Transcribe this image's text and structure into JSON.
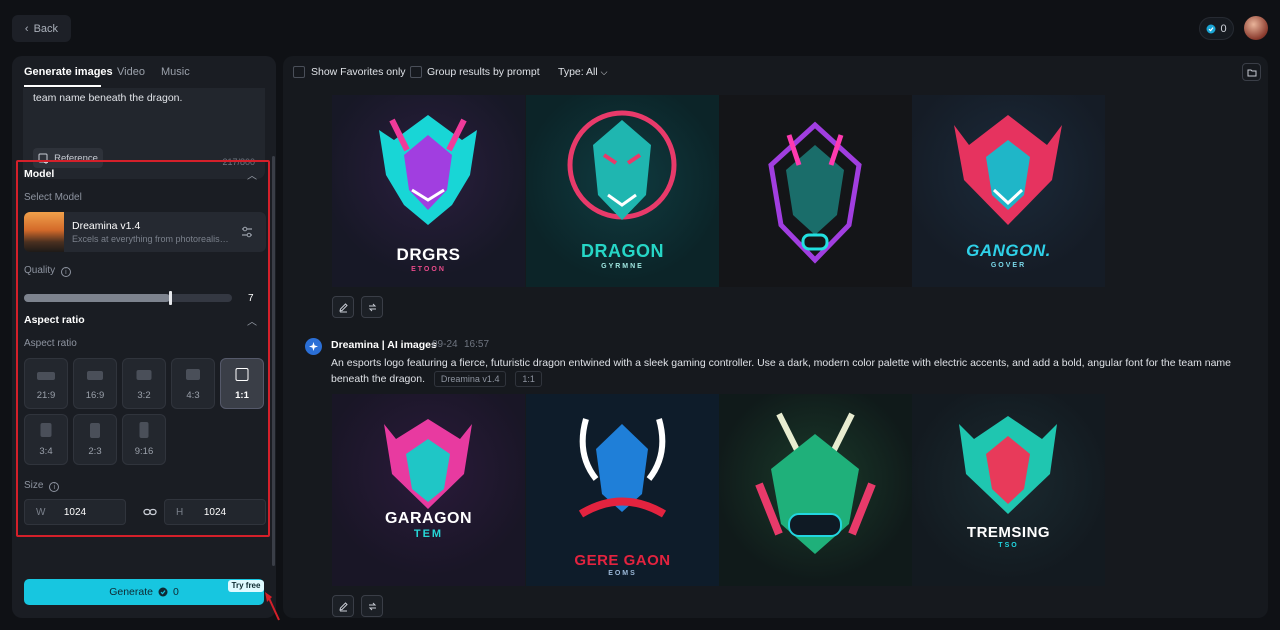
{
  "topbar": {
    "back_label": "Back",
    "credits": "0"
  },
  "left": {
    "tabs": [
      "Generate images",
      "Video",
      "Music"
    ],
    "prompt_tail": "team name beneath the dragon.",
    "reference_label": "Reference",
    "char_count": "217/800",
    "model": {
      "section_title": "Model",
      "select_label": "Select Model",
      "name": "Dreamina v1.4",
      "desc": "Excels at everything from photorealism..."
    },
    "quality": {
      "label": "Quality",
      "value": "7",
      "level_fraction": 0.7
    },
    "aspect": {
      "section_title": "Aspect ratio",
      "label": "Aspect ratio",
      "options": [
        "21:9",
        "16:9",
        "3:2",
        "4:3",
        "1:1",
        "3:4",
        "2:3",
        "9:16"
      ],
      "selected": "1:1"
    },
    "size": {
      "label": "Size",
      "w_label": "W",
      "w_value": "1024",
      "h_label": "H",
      "h_value": "1024"
    },
    "generate": {
      "label": "Generate",
      "credits": "0",
      "badge": "Try free"
    }
  },
  "main": {
    "filters": {
      "favorites": "Show Favorites only",
      "group": "Group results by prompt",
      "type": "Type: All"
    },
    "group1": {
      "images": [
        {
          "text": "DRGRS",
          "sub": "ETOON"
        },
        {
          "text": "DRAGON",
          "sub": "GYRMNE"
        },
        {
          "text": "",
          "sub": ""
        },
        {
          "text": "GANGON.",
          "sub": "GOVER"
        }
      ]
    },
    "group2": {
      "author": "Dreamina | AI images",
      "date": "09-24",
      "time": "16:57",
      "prompt": "An esports logo featuring a fierce, futuristic dragon entwined with a sleek gaming controller. Use a dark, modern color palette with electric accents, and add a bold, angular font for the team name beneath the dragon.",
      "model_chip": "Dreamina v1.4",
      "ratio_chip": "1:1",
      "images": [
        {
          "text": "GARAGON",
          "sub": "TEM"
        },
        {
          "text": "GERE GAON",
          "sub": "EOMS"
        },
        {
          "text": "",
          "sub": ""
        },
        {
          "text": "TREMSING",
          "sub": "TSO"
        }
      ]
    }
  },
  "colors": {
    "accent": "#17c6e0",
    "highlight_border": "#d4202a",
    "panel": "#1a1d23",
    "bg": "#0f1115"
  }
}
